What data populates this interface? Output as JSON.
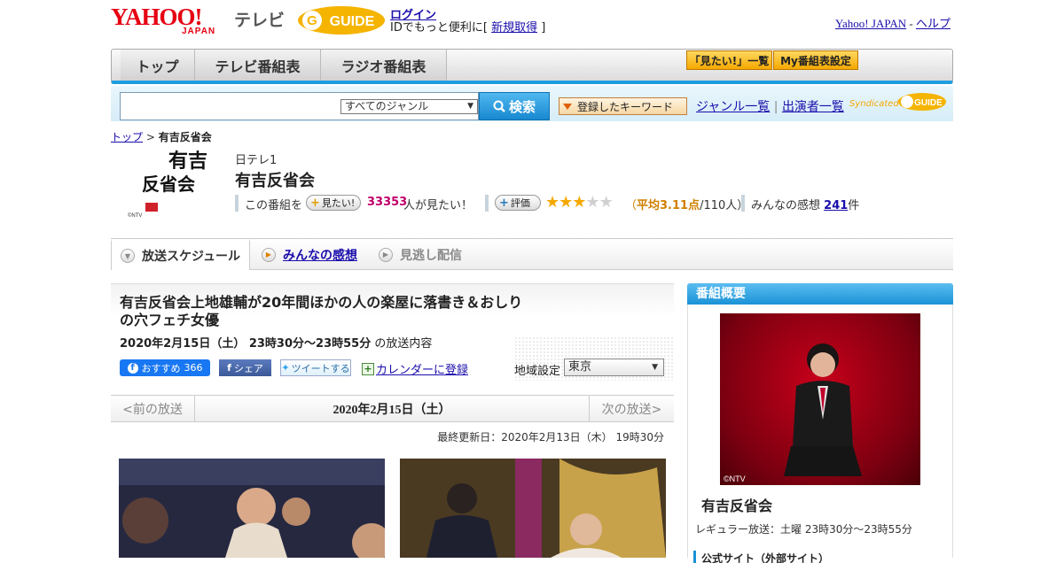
{
  "header": {
    "logo_yahoo": "YAHOO!",
    "logo_japan": "JAPAN",
    "logo_tv": "テレビ",
    "logo_gguide": "GUIDE",
    "login": "ログイン",
    "login_sub_prefix": "IDでもっと便利に[",
    "register": "新規取得",
    "login_sub_suffix": "]",
    "yahoo_japan_link": "Yahoo! JAPAN",
    "separator": "-",
    "help_link": "ヘルプ"
  },
  "nav": {
    "tabs": [
      "トップ",
      "テレビ番組表",
      "ラジオ番組表"
    ],
    "mitai_list": "「見たい!」一覧",
    "my_schedule": "My番組表設定"
  },
  "search": {
    "genre_selected": "すべてのジャンル",
    "search_button": "検索",
    "keyword_button": "登録したキーワード",
    "genre_list": "ジャンル一覧",
    "divider": "|",
    "cast_list": "出演者一覧",
    "syndicated": "Syndicated",
    "syndicated_logo": "GUIDE"
  },
  "breadcrumb": {
    "top": "トップ",
    "sep": ">",
    "current": "有吉反省会"
  },
  "program": {
    "logo_text": [
      "有吉",
      "反省会"
    ],
    "logo_badge": "©NTV",
    "channel": "日テレ1",
    "title": "有吉反省会",
    "this_program": "この番組を",
    "mitai_btn": "見たい!",
    "mitai_count": "33353",
    "mitai_suffix": "人が見たい！",
    "rating_btn": "評価",
    "rating_stars": 3,
    "rating_max": 5,
    "rating_open": "（",
    "rating_avg": "平均3.11点",
    "rating_count": "/110人）",
    "impressions_label": "みんなの感想",
    "impressions_count": "241",
    "impressions_suffix": "件"
  },
  "tabs": {
    "schedule": "放送スケジュール",
    "impressions": "みんなの感想",
    "streaming": "見逃し配信"
  },
  "episode": {
    "title": "有吉反省会上地雄輔が20年間ほかの人の楽屋に落書き＆おしりの穴フェチ女優",
    "date": "2020年2月15日（土） 23時30分～23時55分",
    "date_suffix": "の放送内容",
    "fb_recommend": "おすすめ",
    "fb_count": "366",
    "fb_share": "シェア",
    "tweet": "ツイートする",
    "calendar": "カレンダーに登録",
    "region_label": "地域設定",
    "region_value": "東京"
  },
  "pager": {
    "prev": "<前の放送",
    "current": "2020年2月15日（土）",
    "next": "次の放送>"
  },
  "updated": "最終更新日：2020年2月13日（木） 19時30分",
  "sidebar": {
    "heading": "番組概要",
    "photo_credit": "©NTV",
    "title": "有吉反省会",
    "air_time": "レギュラー放送：土曜 23時30分～23時55分",
    "official_site": "公式サイト（外部サイト）"
  }
}
